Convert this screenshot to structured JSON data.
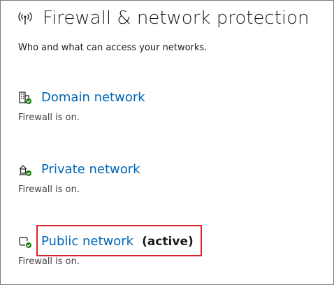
{
  "header": {
    "title": "Firewall & network protection",
    "icon": "broadcast-antenna-icon"
  },
  "subtitle": "Who and what can access your networks.",
  "networks": [
    {
      "label": "Domain network",
      "status": "Firewall is on.",
      "icon": "domain-building-icon",
      "active": false
    },
    {
      "label": "Private network",
      "status": "Firewall is on.",
      "icon": "private-network-icon",
      "active": false
    },
    {
      "label": "Public network",
      "active_label": "(active)",
      "status": "Firewall is on.",
      "icon": "public-network-icon",
      "active": true
    }
  ],
  "colors": {
    "link": "#0067b8",
    "ok_badge": "#107c10",
    "highlight": "#d9232d",
    "text": "#1a1a1a"
  }
}
